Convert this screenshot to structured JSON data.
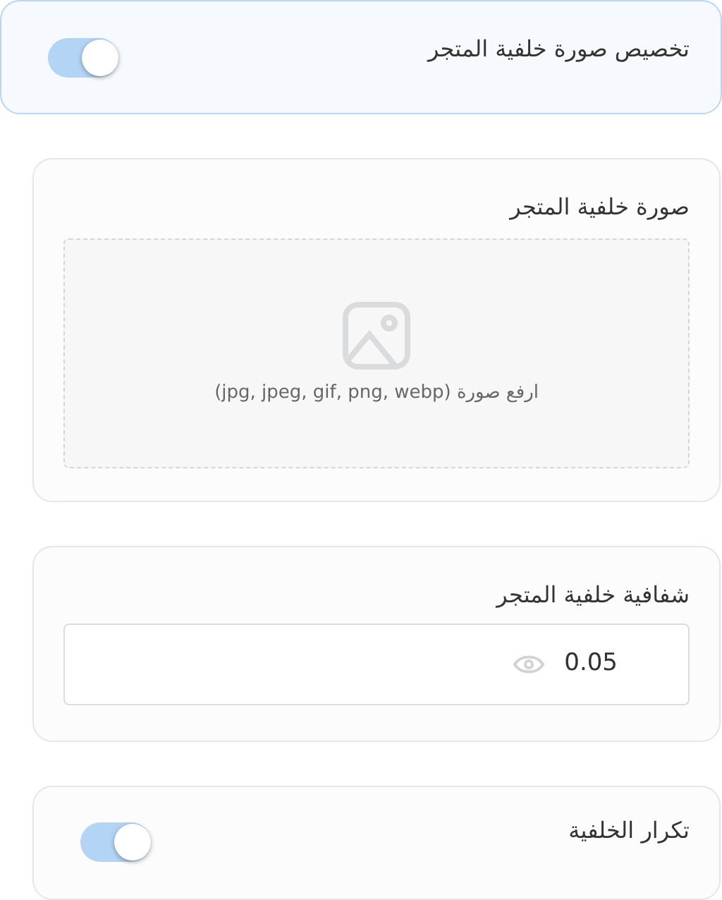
{
  "customize_background": {
    "label": "تخصيص صورة خلفية المتجر",
    "on": true
  },
  "background_image": {
    "label": "صورة خلفية المتجر",
    "upload_hint": "ارفع صورة (jpg, jpeg, gif, png, webp)"
  },
  "background_opacity": {
    "label": "شفافية خلفية المتجر",
    "value": "0.05"
  },
  "repeat_background": {
    "label": "تكرار الخلفية",
    "on": true
  }
}
